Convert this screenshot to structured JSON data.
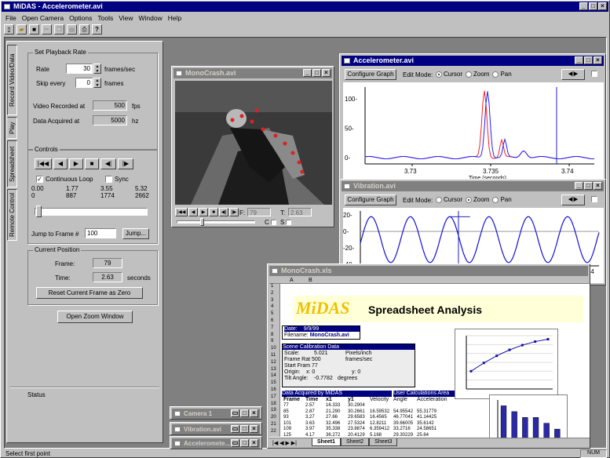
{
  "app": {
    "title": "MiDAS - Accelerometer.avi",
    "status": "Select first point",
    "status_right": "NUM"
  },
  "menu": [
    "File",
    "Open Camera",
    "Options",
    "Tools",
    "View",
    "Window",
    "Help"
  ],
  "tabs": [
    "Record Video/Data",
    "Play",
    "Spreadsheet",
    "Remote Control"
  ],
  "playback": {
    "group": "Set Playback Rate",
    "rate_label": "Rate",
    "rate": "30",
    "rate_unit": "frames/sec",
    "skip_label": "Skip every",
    "skip": "0",
    "skip_unit": "frames",
    "vrec_label": "Video Recorded at",
    "vrec": "500",
    "vrec_unit": "fps",
    "dacq_label": "Data Acquired at",
    "dacq": "5000",
    "dacq_unit": "hz"
  },
  "controls": {
    "group": "Controls",
    "loop": "Continuous Loop",
    "sync": "Sync",
    "scale_top": [
      "0.00",
      "1.77",
      "3.55",
      "5.32"
    ],
    "scale_bot": [
      "0",
      "887",
      "1774",
      "2662"
    ],
    "jump_label": "Jump to Frame #",
    "jump_value": "100",
    "jump_btn": "Jump..."
  },
  "position": {
    "group": "Current Position",
    "frame_label": "Frame:",
    "frame": "79",
    "time_label": "Time:",
    "time": "2.63",
    "time_unit": "seconds",
    "reset_btn": "Reset Current Frame as Zero"
  },
  "zoom_btn": "Open Zoom Window",
  "status_label": "Status",
  "mono": {
    "title": "MonoCrash.avi",
    "f_label": "F:",
    "f": "79",
    "t_label": "T:",
    "t": "2.63",
    "c": "C",
    "s": "S"
  },
  "accel": {
    "title": "Accelerometer.avi",
    "config": "Configure Graph",
    "mode_label": "Edit Mode:",
    "modes": [
      "Cursor",
      "Zoom",
      "Pan"
    ],
    "yticks": [
      "100-",
      "50-",
      "0-"
    ],
    "xticks": [
      "3.73",
      "3.735",
      "3.74"
    ],
    "xlabel": "Time (seconds)"
  },
  "vib": {
    "title": "Vibration.avi",
    "config": "Configure Graph",
    "mode_label": "Edit Mode:",
    "modes": [
      "Cursor",
      "Zoom",
      "Pan"
    ],
    "yticks": [
      "20-",
      "0-",
      "-20-",
      "-40-"
    ],
    "xticks": [
      "0.2",
      "0.4",
      "0.6",
      "0.8",
      "1",
      "1.2",
      "1.4"
    ],
    "xlabel": "Time (seconds)"
  },
  "sheet": {
    "title": "MonoCrash.xls",
    "cols": [
      "A",
      "B"
    ],
    "logo": "MiDAS",
    "heading": "Spreadsheet Analysis",
    "date_label": "Date:",
    "date": "9/9/99",
    "file_label": "Filename:",
    "file": "MonoCrash.avi",
    "calib_title": "Scene Calibration Data",
    "scale_label": "Scale:",
    "scale": "5.021",
    "scale_unit": "Pixels/inch",
    "rate_label": "Frame Rat 500",
    "rate_unit": "frames/sec",
    "start": "Start Fram 77",
    "origin_label": "Origin:",
    "origin_x": "x: 0",
    "origin_y": "y: 0",
    "tilt_label": "Tilt Angle:",
    "tilt": "-0.7782",
    "tilt_unit": "degrees",
    "acq_title": "Data Acquired by MiDAS",
    "user_title": "User Calculations Area",
    "headers": [
      "Frame",
      "Time",
      "x1",
      "y1",
      "Velocity",
      "Angle",
      "Acceleration"
    ],
    "rows": [
      [
        "77",
        "2.57",
        "16.333",
        "30.2904",
        "",
        "",
        ""
      ],
      [
        "85",
        "2.87",
        "21.290",
        "30.2661",
        "16.59532",
        "54.95542",
        "55.31779"
      ],
      [
        "93",
        "3.27",
        "27.66",
        "29.6583",
        "16.4565",
        "46.77041",
        "41.14425"
      ],
      [
        "101",
        "3.63",
        "32.496",
        "27.5324",
        "12.8211",
        "39.66005",
        "35.6142"
      ],
      [
        "109",
        "3.97",
        "35.338",
        "23.8874",
        "6.359412",
        "33.2716",
        "24.58651"
      ],
      [
        "125",
        "4.17",
        "36.272",
        "20.4129",
        "5.168",
        "29.30229",
        "25.64"
      ]
    ],
    "sheets": [
      "Sheet1",
      "Sheet2",
      "Sheet3"
    ],
    "line_values": [
      1.5,
      2.2,
      2.8,
      3.3,
      3.7,
      4.0,
      4.2
    ],
    "bar_values": [
      6,
      5,
      4,
      4,
      3,
      2
    ]
  },
  "minimized": [
    "Camera 1",
    "Vibration.avi",
    "Acceleromete..."
  ]
}
